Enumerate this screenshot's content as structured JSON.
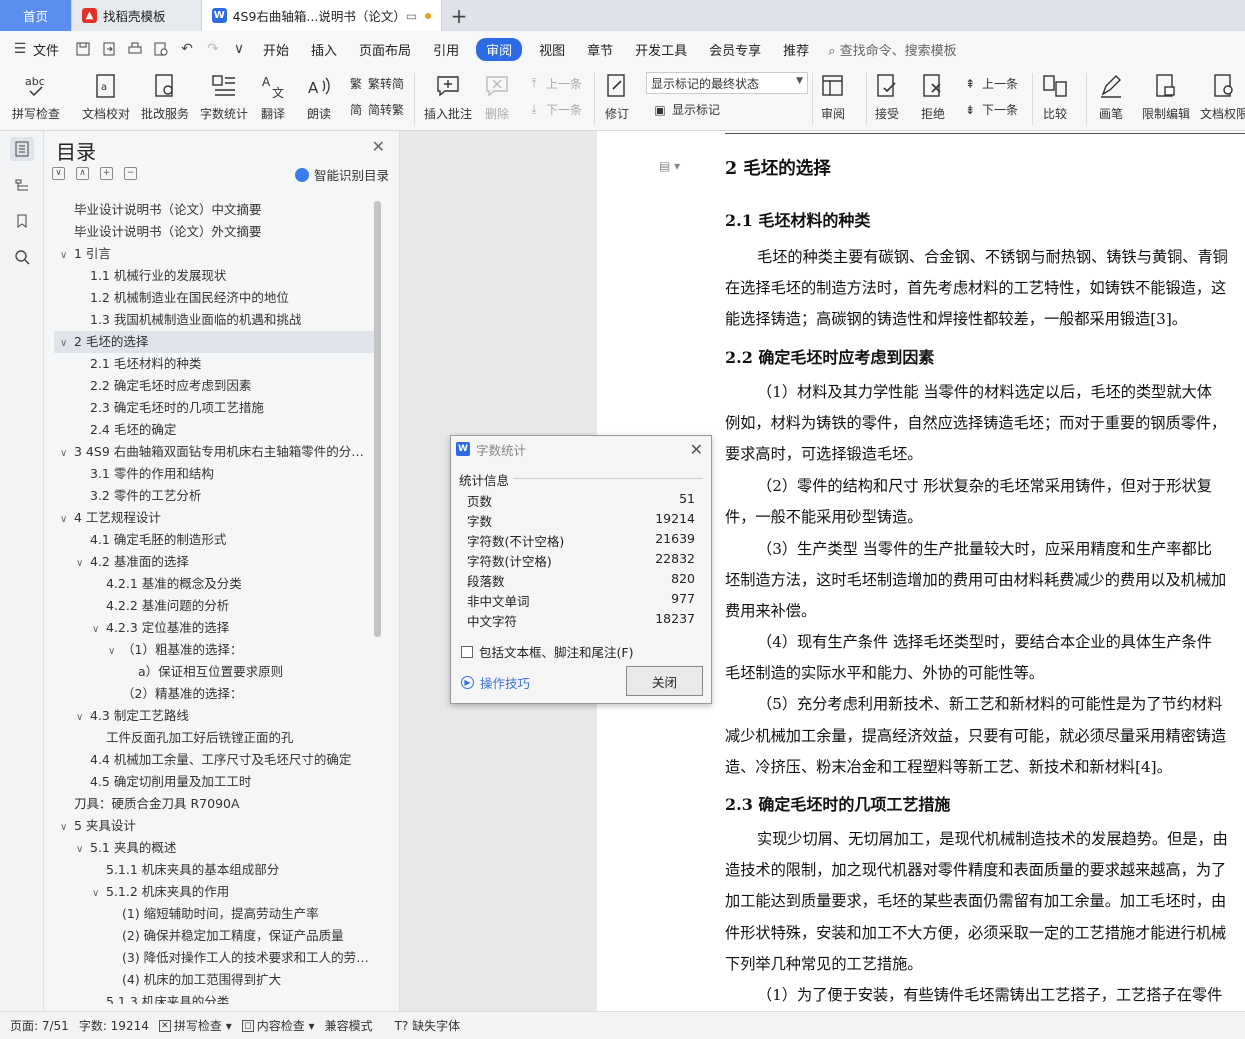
{
  "tabs": {
    "home": "首页",
    "template": "找稻壳模板",
    "document": "4S9右曲轴箱...说明书（论文）"
  },
  "menu": {
    "file": "文件",
    "items": [
      "开始",
      "插入",
      "页面布局",
      "引用",
      "审阅",
      "视图",
      "章节",
      "开发工具",
      "会员专享",
      "推荐"
    ],
    "active": "审阅",
    "search": "查找命令、搜索模板"
  },
  "ribbon": {
    "spell_check": "拼写检查",
    "doc_check": "文档校对",
    "batch": "批改服务",
    "word_count": "字数统计",
    "translate": "翻译",
    "read_aloud": "朗读",
    "trad_to_simp": "繁转简",
    "simp_to_trad": "简转繁",
    "insert_comment": "插入批注",
    "delete": "删除",
    "prev_comment": "上一条",
    "next_comment": "下一条",
    "revise": "修订",
    "markup_select": "显示标记的最终状态",
    "show_markup": "显示标记",
    "review": "审阅",
    "accept": "接受",
    "reject": "拒绝",
    "prev_change": "上一条",
    "next_change": "下一条",
    "compare": "比较",
    "pen": "画笔",
    "restrict": "限制编辑",
    "permission": "文档权限"
  },
  "toc": {
    "title": "目录",
    "smart": "智能识别目录",
    "items": [
      {
        "text": "毕业设计说明书（论文）中文摘要",
        "level": 0,
        "caret": ""
      },
      {
        "text": "毕业设计说明书（论文）外文摘要",
        "level": 0,
        "caret": ""
      },
      {
        "text": "1   引言",
        "level": 0,
        "caret": "∨"
      },
      {
        "text": "1.1   机械行业的发展现状",
        "level": 1,
        "caret": ""
      },
      {
        "text": "1.2   机械制造业在国民经济中的地位",
        "level": 1,
        "caret": ""
      },
      {
        "text": "1.3   我国机械制造业面临的机遇和挑战",
        "level": 1,
        "caret": ""
      },
      {
        "text": "2   毛坯的选择",
        "level": 0,
        "caret": "∨",
        "selected": true
      },
      {
        "text": "2.1   毛坯材料的种类",
        "level": 1,
        "caret": ""
      },
      {
        "text": "2.2   确定毛坯时应考虑到因素",
        "level": 1,
        "caret": ""
      },
      {
        "text": "2.3   确定毛坯时的几项工艺措施",
        "level": 1,
        "caret": ""
      },
      {
        "text": "2.4   毛坯的确定",
        "level": 1,
        "caret": ""
      },
      {
        "text": "3   4S9 右曲轴箱双面钻专用机床右主轴箱零件的分析...",
        "level": 0,
        "caret": "∨"
      },
      {
        "text": "3.1   零件的作用和结构",
        "level": 1,
        "caret": ""
      },
      {
        "text": "3.2   零件的工艺分析",
        "level": 1,
        "caret": ""
      },
      {
        "text": "4   工艺规程设计",
        "level": 0,
        "caret": "∨"
      },
      {
        "text": "4.1   确定毛胚的制造形式",
        "level": 1,
        "caret": ""
      },
      {
        "text": "4.2   基准面的选择",
        "level": 1,
        "caret": "∨"
      },
      {
        "text": "4.2.1   基准的概念及分类",
        "level": 2,
        "caret": ""
      },
      {
        "text": "4.2.2   基准问题的分析",
        "level": 2,
        "caret": ""
      },
      {
        "text": "4.2.3   定位基准的选择",
        "level": 2,
        "caret": "∨"
      },
      {
        "text": "（1）粗基准的选择：",
        "level": 3,
        "caret": "∨"
      },
      {
        "text": "a）保证相互位置要求原则",
        "level": 4,
        "caret": ""
      },
      {
        "text": "（2）精基准的选择：",
        "level": 3,
        "caret": ""
      },
      {
        "text": "4.3   制定工艺路线",
        "level": 1,
        "caret": "∨"
      },
      {
        "text": "工件反面孔加工好后铣镗正面的孔",
        "level": 2,
        "caret": ""
      },
      {
        "text": "4.4   机械加工余量、工序尺寸及毛坯尺寸的确定",
        "level": 1,
        "caret": ""
      },
      {
        "text": "4.5   确定切削用量及加工工时",
        "level": 1,
        "caret": ""
      },
      {
        "text": "刀具：硬质合金刀具 R7090A",
        "level": 0,
        "caret": ""
      },
      {
        "text": "5   夹具设计",
        "level": 0,
        "caret": "∨"
      },
      {
        "text": "5.1   夹具的概述",
        "level": 1,
        "caret": "∨"
      },
      {
        "text": "5.1.1   机床夹具的基本组成部分",
        "level": 2,
        "caret": ""
      },
      {
        "text": "5.1.2   机床夹具的作用",
        "level": 2,
        "caret": "∨"
      },
      {
        "text": "(1) 缩短辅助时间，提高劳动生产率",
        "level": 3,
        "caret": ""
      },
      {
        "text": "(2) 确保并稳定加工精度，保证产品质量",
        "level": 3,
        "caret": ""
      },
      {
        "text": "(3) 降低对操作工人的技术要求和工人的劳动强...",
        "level": 3,
        "caret": ""
      },
      {
        "text": "(4) 机床的加工范围得到扩大",
        "level": 3,
        "caret": ""
      },
      {
        "text": "5.1.3   机床夹具的分类",
        "level": 2,
        "caret": ""
      }
    ]
  },
  "document": {
    "h_main": "2    毛坯的选择",
    "h_21": "2.1    毛坯材料的种类",
    "p1": "毛坯的种类主要有碳钢、合金钢、不锈钢与耐热钢、铸铁与黄铜、青铜",
    "p2": "在选择毛坯的制造方法时，首先考虑材料的工艺特性，如铸铁不能锻造，这",
    "p3": "能选择铸造；高碳钢的铸造性和焊接性都较差，一般都采用锻造[3]。",
    "h_22": "2.2    确定毛坯时应考虑到因素",
    "p4": "（1）材料及其力学性能    当零件的材料选定以后，毛坯的类型就大体",
    "p5": "例如，材料为铸铁的零件，自然应选择铸造毛坯；而对于重要的钢质零件，",
    "p6": "要求高时，可选择锻造毛坯。",
    "p7": "（2）零件的结构和尺寸    形状复杂的毛坯常采用铸件，但对于形状复",
    "p8": "件，一般不能采用砂型铸造。",
    "p9": "（3）生产类型    当零件的生产批量较大时，应采用精度和生产率都比",
    "p10": "坯制造方法，这时毛坯制造增加的费用可由材料耗费减少的费用以及机械加",
    "p11": "费用来补偿。",
    "p12": "（4）现有生产条件    选择毛坯类型时，要结合本企业的具体生产条件",
    "p13": "毛坯制造的实际水平和能力、外协的可能性等。",
    "p14": "（5）充分考虑利用新技术、新工艺和新材料的可能性是为了节约材料",
    "p15": "减少机械加工余量，提高经济效益，只要有可能，就必须尽量采用精密铸造",
    "p16": "造、冷挤压、粉末冶金和工程塑料等新工艺、新技术和新材料[4]。",
    "h_23": "2.3    确定毛坯时的几项工艺措施",
    "p17": "实现少切屑、无切屑加工，是现代机械制造技术的发展趋势。但是，由",
    "p18": "造技术的限制，加之现代机器对零件精度和表面质量的要求越来越高，为了",
    "p19": "加工能达到质量要求，毛坯的某些表面仍需留有加工余量。加工毛坯时，由",
    "p20": "件形状特殊，安装和加工不大方便，必须采取一定的工艺措施才能进行机械",
    "p21": "下列举几种常见的工艺措施。",
    "p22": "（1）为了便于安装，有些铸件毛坯需铸出工艺搭子，工艺搭子在零件"
  },
  "dialog": {
    "title": "字数统计",
    "section": "统计信息",
    "rows": [
      {
        "label": "页数",
        "value": "51"
      },
      {
        "label": "字数",
        "value": "19214"
      },
      {
        "label": "字符数(不计空格)",
        "value": "21639"
      },
      {
        "label": "字符数(计空格)",
        "value": "22832"
      },
      {
        "label": "段落数",
        "value": "820"
      },
      {
        "label": "非中文单词",
        "value": "977"
      },
      {
        "label": "中文字符",
        "value": "18237"
      }
    ],
    "checkbox": "包括文本框、脚注和尾注(F)",
    "tips": "操作技巧",
    "close": "关闭"
  },
  "status": {
    "page": "页面: 7/51",
    "words": "字数: 19214",
    "spell": "拼写检查",
    "content": "内容检查",
    "compat": "兼容模式",
    "missing_font": "缺失字体"
  },
  "colors": {
    "accent": "#2d6be4",
    "home_tab": "#5b8def"
  }
}
